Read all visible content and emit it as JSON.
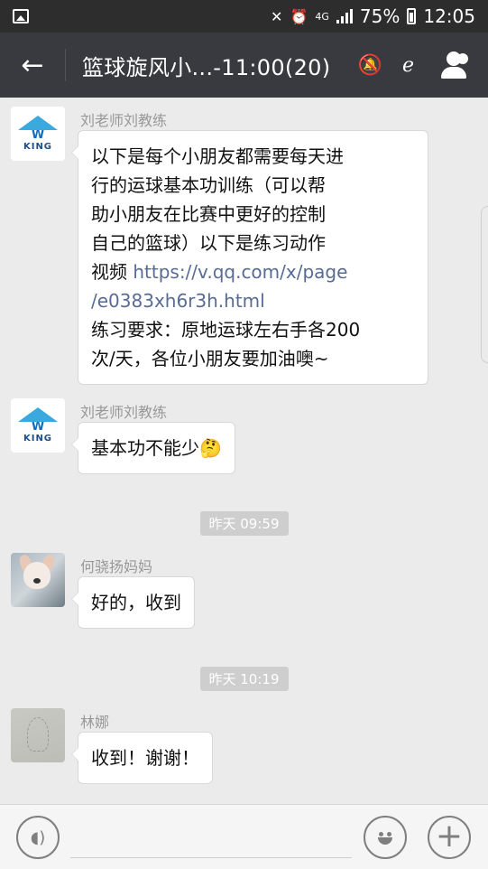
{
  "status_bar": {
    "network": "4G",
    "battery": "75%",
    "time": "12:05"
  },
  "title_bar": {
    "back_icon": "back-arrow-icon",
    "title": "篮球旋风小...-11:00(20)",
    "icons": [
      "mute-icon",
      "earpiece-icon",
      "group-members-icon"
    ]
  },
  "messages": [
    {
      "sender": "刘老师刘教练",
      "avatar": "king-logo-avatar",
      "lines": [
        "以下是每个小朋友都需要每天进",
        "行的运球基本功训练（可以帮",
        "助小朋友在比赛中更好的控制",
        "自己的篮球）以下是练习动作"
      ],
      "link_prefix": "视频 ",
      "link_line1": "https://v.qq.com/x/page",
      "link_line2": "/e0383xh6r3h.html",
      "tail_lines": [
        "练习要求：原地运球左右手各200",
        "次/天，各位小朋友要加油噢~"
      ]
    },
    {
      "sender": "刘老师刘教练",
      "avatar": "king-logo-avatar",
      "text": "基本功不能少",
      "emoji": "🤔"
    },
    {
      "timestamp": "昨天 09:59"
    },
    {
      "sender": "何骁扬妈妈",
      "avatar": "dog-avatar",
      "text": "好的，收到"
    },
    {
      "timestamp": "昨天 10:19"
    },
    {
      "sender": "林娜",
      "avatar": "sketch-avatar",
      "text": "收到！谢谢！"
    }
  ],
  "logo_text": {
    "w": "W",
    "king": "KING"
  },
  "bottom_bar": {
    "voice_icon": "voice-input-icon",
    "emoji_icon": "emoji-icon",
    "plus_icon": "plus-icon"
  }
}
